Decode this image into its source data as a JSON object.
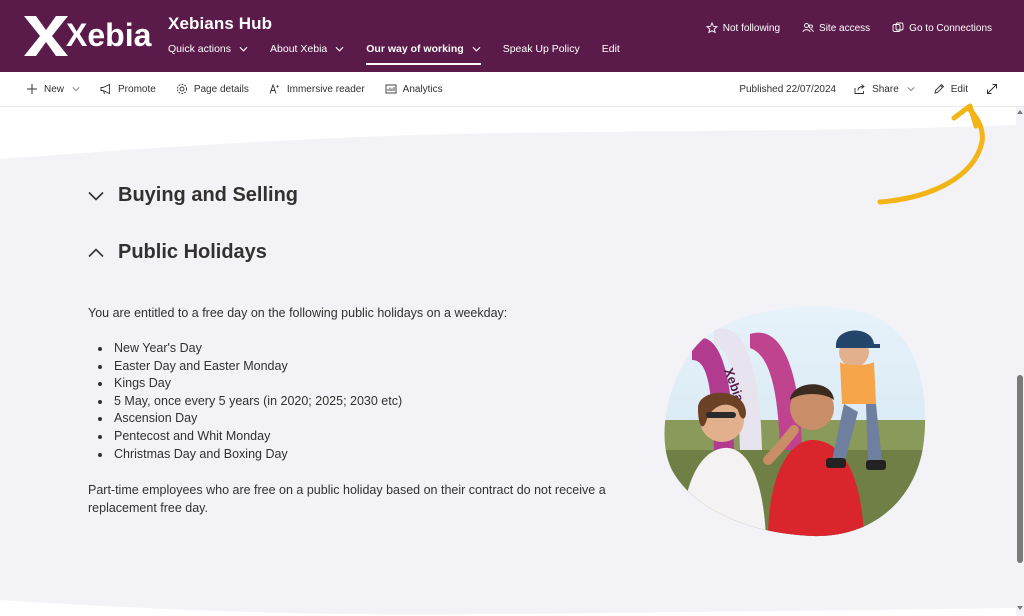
{
  "header": {
    "logo_text": "Xebia",
    "site_title": "Xebians Hub",
    "nav": [
      {
        "label": "Quick actions",
        "has_dropdown": true
      },
      {
        "label": "About Xebia",
        "has_dropdown": true
      },
      {
        "label": "Our way of working",
        "has_dropdown": true,
        "active": true
      },
      {
        "label": "Speak Up Policy",
        "has_dropdown": false
      },
      {
        "label": "Edit",
        "has_dropdown": false
      }
    ],
    "actions": {
      "follow": {
        "label": "Not following",
        "icon": "star-icon"
      },
      "access": {
        "label": "Site access",
        "icon": "people-icon"
      },
      "connections": {
        "label": "Go to Connections",
        "icon": "connections-icon"
      }
    },
    "colors": {
      "bar": "#5a1b4a",
      "text": "#ffffff"
    }
  },
  "commandbar": {
    "new": {
      "label": "New",
      "icon": "plus-icon"
    },
    "promote": {
      "label": "Promote",
      "icon": "megaphone-icon"
    },
    "page_details": {
      "label": "Page details",
      "icon": "gear-icon"
    },
    "immersive_reader": {
      "label": "Immersive reader",
      "icon": "immersive-reader-icon"
    },
    "analytics": {
      "label": "Analytics",
      "icon": "analytics-icon"
    },
    "published": "Published 22/07/2024",
    "share": {
      "label": "Share",
      "icon": "share-icon"
    },
    "edit": {
      "label": "Edit",
      "icon": "pencil-icon"
    },
    "expand": {
      "icon": "expand-icon"
    }
  },
  "content": {
    "sections": [
      {
        "title": "Buying and Selling",
        "expanded": false
      },
      {
        "title": "Public Holidays",
        "expanded": true
      }
    ],
    "intro": "You are entitled to a free day on the following public holidays on a weekday:",
    "holidays": [
      "New Year's Day",
      "Easter Day and Easter Monday",
      "Kings Day",
      "5 May, once every 5 years (in 2020; 2025; 2030 etc)",
      "Ascension Day",
      "Pentecost and Whit Monday",
      "Christmas Day and Boxing Day"
    ],
    "note_line1": "Part-time employees who are free on a public holiday based on their contract do not receive a",
    "note_line2": "replacement free day.",
    "photo_flag_text": "Xebia"
  },
  "annotation": {
    "arrow_color": "#f2b417"
  }
}
